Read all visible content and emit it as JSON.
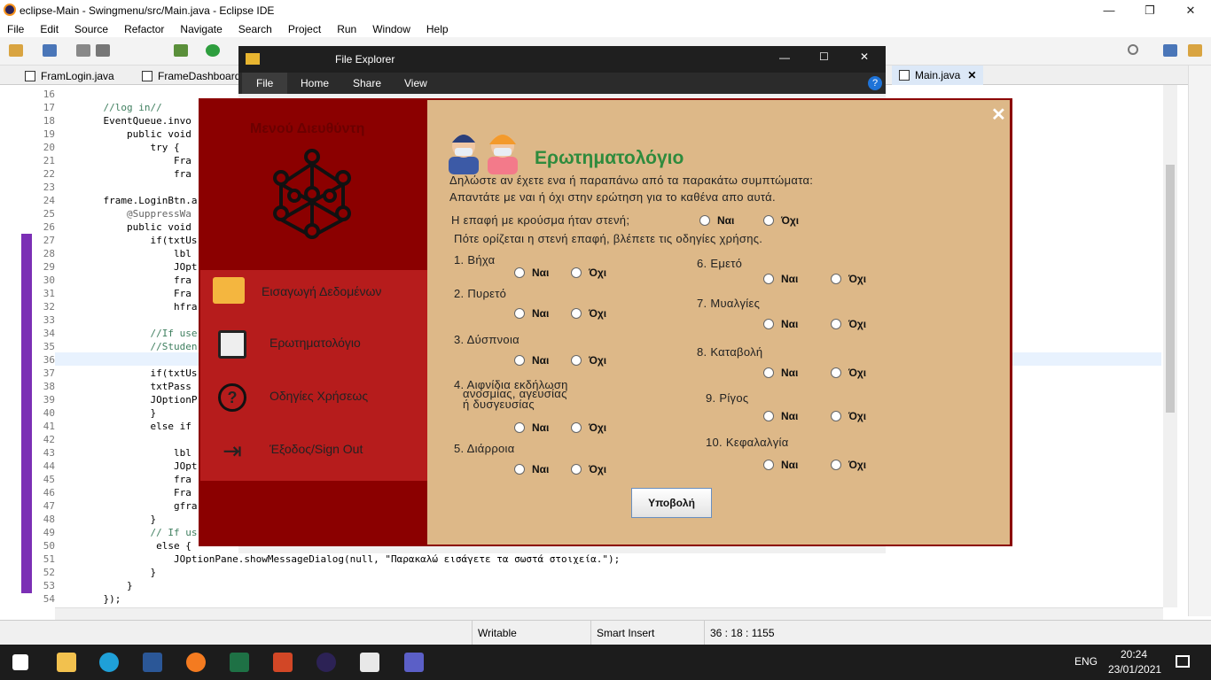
{
  "titlebar": {
    "title": "eclipse-Main - Swingmenu/src/Main.java - Eclipse IDE"
  },
  "menubar": {
    "items": [
      "File",
      "Edit",
      "Source",
      "Refactor",
      "Navigate",
      "Search",
      "Project",
      "Run",
      "Window",
      "Help"
    ]
  },
  "editor_tabs": [
    "FramLogin.java",
    "FrameDashboard",
    "Main.java"
  ],
  "line_numbers": [
    "16",
    "17",
    "18",
    "19",
    "20",
    "21",
    "22",
    "23",
    "24",
    "25",
    "26",
    "27",
    "28",
    "29",
    "30",
    "31",
    "32",
    "33",
    "34",
    "35",
    "36",
    "37",
    "38",
    "39",
    "40",
    "41",
    "42",
    "43",
    "44",
    "45",
    "46",
    "47",
    "48",
    "49",
    "50",
    "51",
    "52",
    "53",
    "54"
  ],
  "code_lines": [
    "",
    "    //log in//",
    "    EventQueue.invo",
    "        public void",
    "            try {",
    "                Fra",
    "                fra",
    "",
    "    frame.LoginBtn.a",
    "        @SuppressWa",
    "        public void",
    "            if(txtUs",
    "                lbl",
    "                JOpt",
    "                fra",
    "                Fra",
    "                hfra",
    "",
    "            //If use",
    "            //Studen",
    "            }",
    "            if(txtUs",
    "            txtPass",
    "            JOptionP",
    "            }",
    "            else if",
    "",
    "                lbl",
    "                JOpt",
    "                fra",
    "                Fra",
    "                gfra",
    "            }",
    "            // If us",
    "             else {",
    "                JOptionPane.showMessageDialog(null, \"Παρακαλώ εισάγετε τα σωστά στοιχεία.\");",
    "            }",
    "        }",
    "    });"
  ],
  "file_explorer": {
    "title": "File Explorer",
    "ribbon": [
      "File",
      "Home",
      "Share",
      "View"
    ]
  },
  "sidebar": {
    "title": "Μενού Διευθύντη",
    "items": [
      "Εισαγωγή Δεδομένων",
      "Ερωτηματολόγιο",
      "Οδηγίες Χρήσεως",
      "Έξοδος/Sign Out"
    ]
  },
  "form": {
    "heading": "Ερωτηματολόγιο",
    "intro1": "Δηλώστε αν έχετε ενα ή παραπάνω από τα παρακάτω συμπτώματα:",
    "intro2": "Απαντάτε με ναι ή όχι στην ερώτηση για το καθένα απο αυτά.",
    "contact_q": "Η επαφή με κρούσμα ήταν στενή;",
    "contact_note": "Πότε ορίζεται η στενή επαφή, βλέπετε τις οδηγίες χρήσης.",
    "yes": "Ναι",
    "no": "Όχι",
    "symptoms": [
      "1. Βήχα",
      "2. Πυρετό",
      "3. Δύσπνοια",
      "4. Αιφνίδια εκδήλωση",
      "ανοσμίας, αγευσίας",
      "ή δυσγευσίας",
      "5. Διάρροια",
      "6. Εμετό",
      "7. Μυαλγίες",
      "8. Καταβολή",
      "9. Ρίγος",
      "10. Κεφαλαλγία"
    ],
    "submit": "Υποβολή",
    "close": "✕"
  },
  "status": {
    "writable": "Writable",
    "insert": "Smart Insert",
    "position": "36 : 18 : 1155"
  },
  "taskbar": {
    "lang": "ENG",
    "time": "20:24",
    "date": "23/01/2021"
  },
  "colors": {
    "dialog_red": "#8b0000",
    "panel_red": "#b61c1c",
    "form_bg": "#ddb888",
    "heading_green": "#2e8b3d"
  }
}
